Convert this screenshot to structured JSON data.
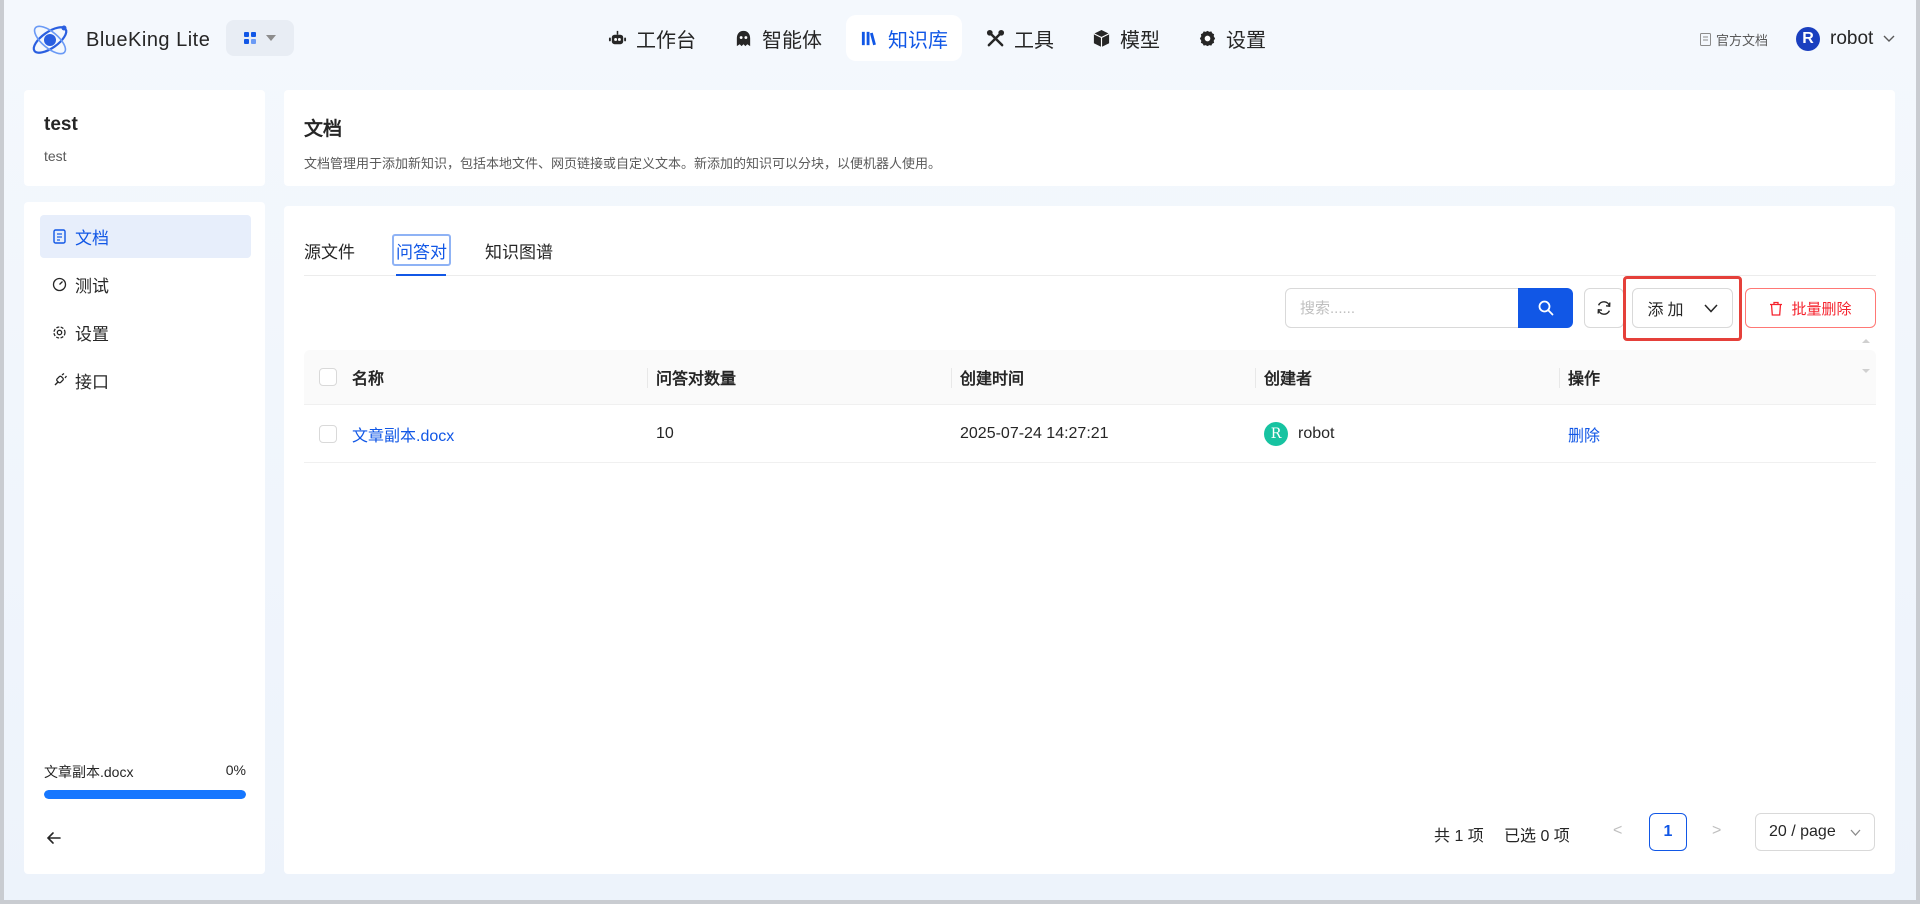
{
  "brand": {
    "name": "BlueKing Lite"
  },
  "nav": {
    "items": [
      {
        "label": "工作台",
        "icon": "robot-icon"
      },
      {
        "label": "智能体",
        "icon": "agent-icon"
      },
      {
        "label": "知识库",
        "icon": "library-icon",
        "active": true
      },
      {
        "label": "工具",
        "icon": "tools-icon"
      },
      {
        "label": "模型",
        "icon": "cube-icon"
      },
      {
        "label": "设置",
        "icon": "gear-icon"
      }
    ]
  },
  "header": {
    "doc_link": "官方文档",
    "user_initial": "R",
    "user_name": "robot"
  },
  "knowledge_base": {
    "name": "test",
    "description": "test"
  },
  "sidebar": {
    "items": [
      {
        "label": "文档",
        "icon": "document-icon",
        "active": true
      },
      {
        "label": "测试",
        "icon": "gauge-icon"
      },
      {
        "label": "设置",
        "icon": "gear-icon"
      },
      {
        "label": "接口",
        "icon": "plug-icon"
      }
    ],
    "progress": {
      "file": "文章副本.docx",
      "percent_label": "0%",
      "value": 0
    }
  },
  "main": {
    "title": "文档",
    "description": "文档管理用于添加新知识，包括本地文件、网页链接或自定义文本。新添加的知识可以分块，以便机器人使用。",
    "tabs": [
      {
        "label": "源文件"
      },
      {
        "label": "问答对",
        "active": true
      },
      {
        "label": "知识图谱"
      }
    ],
    "search": {
      "placeholder": "搜索......",
      "value": ""
    },
    "add_label": "添加",
    "batch_delete_label": "批量删除",
    "table": {
      "columns": [
        "名称",
        "问答对数量",
        "创建时间",
        "创建者",
        "操作"
      ],
      "rows": [
        {
          "name": "文章副本.docx",
          "qa_count": "10",
          "created_at": "2025-07-24 14:27:21",
          "creator_initial": "R",
          "creator": "robot",
          "action": "删除"
        }
      ]
    },
    "pagination": {
      "total": "共 1 项",
      "selected": "已选 0 项",
      "prev": "<",
      "current_page": "1",
      "next": ">",
      "page_size": "20 / page"
    }
  },
  "colors": {
    "accent": "#1157e6",
    "danger": "#f5222d",
    "highlight_box": "#e5403a",
    "creator_avatar": "#17c3a1"
  }
}
